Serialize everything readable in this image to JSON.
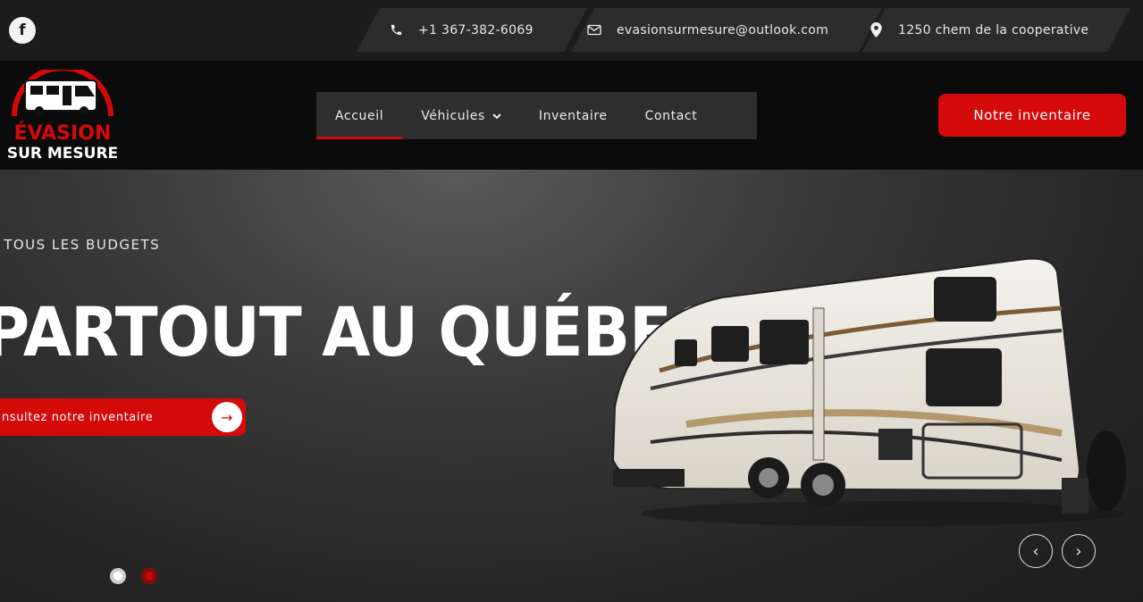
{
  "topbar": {
    "facebook_icon": "facebook-icon",
    "phone": "+1 367-382-6069",
    "email": "evasionsurmesure@outlook.com",
    "address": "1250 chem de la cooperative"
  },
  "brand": {
    "line1": "ÉVASION",
    "line2": "SUR MESURE",
    "red": "#d4090a"
  },
  "nav": {
    "items": [
      {
        "label": "Accueil",
        "active": true
      },
      {
        "label": "Véhicules",
        "has_dropdown": true
      },
      {
        "label": "Inventaire"
      },
      {
        "label": "Contact"
      }
    ]
  },
  "header": {
    "cta_label": "Notre inventaire"
  },
  "hero": {
    "subtitle": "R TOUS LES BUDGETS",
    "headline": "PARTOUT AU QUÉBEC",
    "button_label": "nsultez notre inventaire",
    "slide_count": 2,
    "active_slide": 1
  }
}
